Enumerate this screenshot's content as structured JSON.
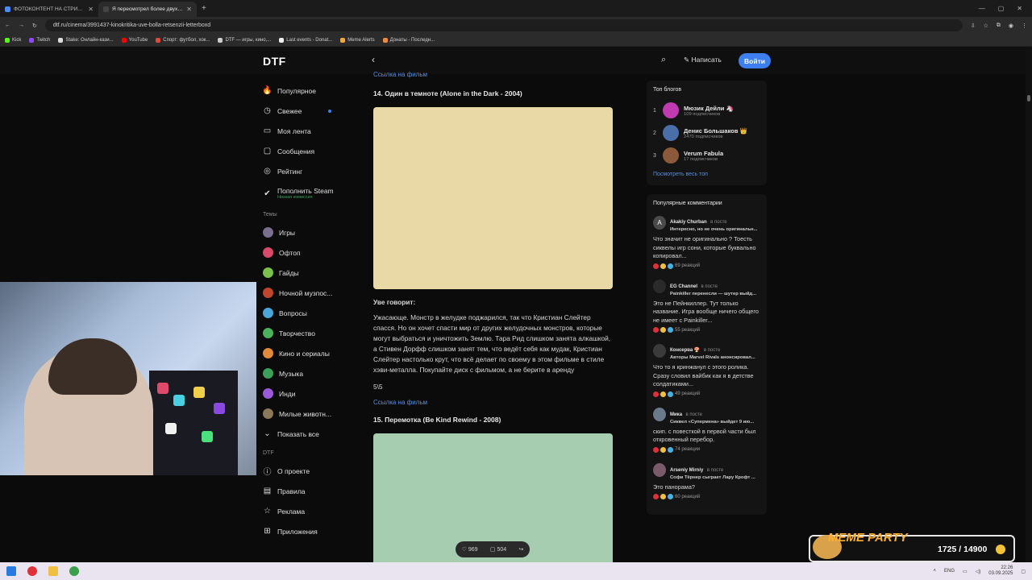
{
  "browser": {
    "tabs": [
      {
        "title": "ФОТОКОНТЕНТ НА СТРИМ М",
        "active": false
      },
      {
        "title": "Я пересмотрел более двух сотен к",
        "active": true
      }
    ],
    "url": "dtf.ru/cinema/3991437-kinokritika-uve-bolla-retsenzii-letterboxd",
    "bookmarks": [
      "Kick",
      "Twitch",
      "Stake: Онлайн-кази...",
      "YouTube",
      "Спорт: футбол, хок...",
      "DTF — игры, кино,...",
      "Last events - Donat...",
      "Meme Alerts",
      "Донаты - Последн..."
    ]
  },
  "header": {
    "logo": "DTF",
    "write_label": "Написать",
    "login_label": "Войти"
  },
  "sidebar": {
    "main": [
      {
        "label": "Популярное",
        "icon": "flame-icon",
        "glyph": "🔥"
      },
      {
        "label": "Свежее",
        "icon": "clock-icon",
        "glyph": "◷",
        "dot": true
      },
      {
        "label": "Моя лента",
        "icon": "feed-icon",
        "glyph": "▭"
      },
      {
        "label": "Сообщения",
        "icon": "chat-icon",
        "glyph": "▢"
      },
      {
        "label": "Рейтинг",
        "icon": "rating-icon",
        "glyph": "◎"
      }
    ],
    "steam": {
      "label": "Пополнить Steam",
      "sub": "Низкая комиссия"
    },
    "topics_label": "Темы",
    "topics": [
      {
        "label": "Игры",
        "color": "#7a6f8e"
      },
      {
        "label": "Офтоп",
        "color": "#d94a6a"
      },
      {
        "label": "Гайды",
        "color": "#7ac04a"
      },
      {
        "label": "Ночной музпос...",
        "color": "#c0452d"
      },
      {
        "label": "Вопросы",
        "color": "#4aa6d9"
      },
      {
        "label": "Творчество",
        "color": "#4ab05a"
      },
      {
        "label": "Кино и сериалы",
        "color": "#e08a3a"
      },
      {
        "label": "Музыка",
        "color": "#3aa05a"
      },
      {
        "label": "Инди",
        "color": "#9b5ad9"
      },
      {
        "label": "Милые животн...",
        "color": "#8a7a5a"
      }
    ],
    "show_all": "Показать все",
    "dtf_label": "DTF",
    "dtf_items": [
      {
        "label": "О проекте",
        "icon": "info-icon",
        "glyph": "ⓘ"
      },
      {
        "label": "Правила",
        "icon": "rules-icon",
        "glyph": "▤"
      },
      {
        "label": "Реклама",
        "icon": "ads-icon",
        "glyph": "☆"
      },
      {
        "label": "Приложения",
        "icon": "apps-icon",
        "glyph": "⊞"
      }
    ]
  },
  "article": {
    "top_link": "Ссылка на фильм",
    "film14_title": "14. Один в темноте (Alone in the Dark - 2004)",
    "says": "Уве говорит:",
    "review": "Ужасающе. Монстр в желудке поджарился, так что Кристиан Слейтер спасся. Но он хочет спасти мир от других желудочных монстров, которые могут выбраться и уничтожить Землю. Тара Рид слишком занята алкашкой, а Стивен Дорфф слишком занят тем, что ведёт себя как мудак, Кристиан Слейтер настолько крут, что всё делает по своему в этом фильме в стиле хэви-металла. Покупайте диск с фильмом, а не берите в аренду",
    "score": "5\\5",
    "link": "Ссылка на фильм",
    "film15_title": "15. Перемотка (Be Kind Rewind - 2008)"
  },
  "reactions": {
    "likes": "969",
    "comments": "504"
  },
  "top_blogs": {
    "title": "Топ блогов",
    "items": [
      {
        "rank": "1",
        "name": "Мюзик Дейли 🦄",
        "subs": "109 подписчиков",
        "color": "#c03ab0"
      },
      {
        "rank": "2",
        "name": "Денис Большаков 👑",
        "subs": "2470 подписчиков",
        "color": "#4a6fa8"
      },
      {
        "rank": "3",
        "name": "Verum Fabula",
        "subs": "17 подписчиков",
        "color": "#8a5a3a"
      }
    ],
    "more": "Посмотреть весь топ"
  },
  "comments": {
    "title": "Популярные комментарии",
    "in_post": "в посте",
    "items": [
      {
        "author": "Akakiy Churban",
        "post": "Интересно, но не очень оригинальн...",
        "text": "Что значит не оригинально ? Тоесть сиквелы игр сони, которые буквально копировал...",
        "reactions": "69 реакций",
        "avatar": "A",
        "color": "#4a4a4a"
      },
      {
        "author": "EG Channel",
        "post": "Painkiller перенесли — шутер выйд...",
        "text": "Это не Пейнкиллер. Тут только название. Игра вообще ничего общего не имеет с Painkiller...",
        "reactions": "55 реакций",
        "avatar": "",
        "color": "#2a2a2a"
      },
      {
        "author": "Консерва 🍄",
        "post": "Авторы Marvel Rivals анонсировал...",
        "text": "Что то я кринжанул с этого ролика. Сразу словил вайбик как я в детстве солдатиками...",
        "reactions": "49 реакций",
        "avatar": "",
        "color": "#3a3a3a"
      },
      {
        "author": "Мика",
        "post": "Сиквел «Супермена» выйдет 9 ию...",
        "text": "скип. с повесткой в первой части был откровенный перебор.",
        "reactions": "74 реакции",
        "avatar": "",
        "color": "#6a7a8a"
      },
      {
        "author": "Arseniy Mirniy",
        "post": "Софи Тёрнер сыграет Лару Крофт ...",
        "text": "Это панорама?",
        "reactions": "60 реакций",
        "avatar": "",
        "color": "#7a5a6a"
      }
    ]
  },
  "overlay": {
    "meme_title": "MEME PARTY",
    "count": "1725 / 14900"
  },
  "taskbar": {
    "lang": "ENG",
    "time": "22:26",
    "date": "03.09.2025"
  }
}
